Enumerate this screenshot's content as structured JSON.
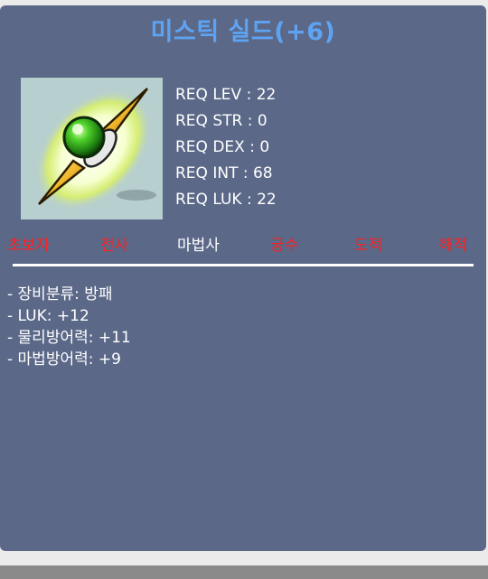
{
  "item": {
    "name": "미스틱 실드(+6)",
    "icon": "mystic-shield-icon"
  },
  "requirements": [
    {
      "label": "REQ LEV",
      "value": "22",
      "text": "REQ LEV : 22"
    },
    {
      "label": "REQ STR",
      "value": "0",
      "text": "REQ STR : 0"
    },
    {
      "label": "REQ DEX",
      "value": "0",
      "text": "REQ DEX : 0"
    },
    {
      "label": "REQ INT",
      "value": "68",
      "text": "REQ INT : 68"
    },
    {
      "label": "REQ LUK",
      "value": "22",
      "text": "REQ LUK : 22"
    }
  ],
  "jobs": [
    {
      "name": "초보자",
      "equippable": false
    },
    {
      "name": "전사",
      "equippable": false
    },
    {
      "name": "마법사",
      "equippable": true
    },
    {
      "name": "궁수",
      "equippable": false
    },
    {
      "name": "도적",
      "equippable": false
    },
    {
      "name": "해적",
      "equippable": false
    }
  ],
  "stats": [
    "- 장비분류: 방패",
    "- LUK: +12",
    "- 물리방어력: +11",
    "- 마법방어력: +9"
  ],
  "colors": {
    "panel": "#5b6888",
    "title": "#5ea3f2",
    "job_available": "#ffffff",
    "job_unavailable": "#ff1f1f",
    "icon_background": "#b7cfcf"
  }
}
